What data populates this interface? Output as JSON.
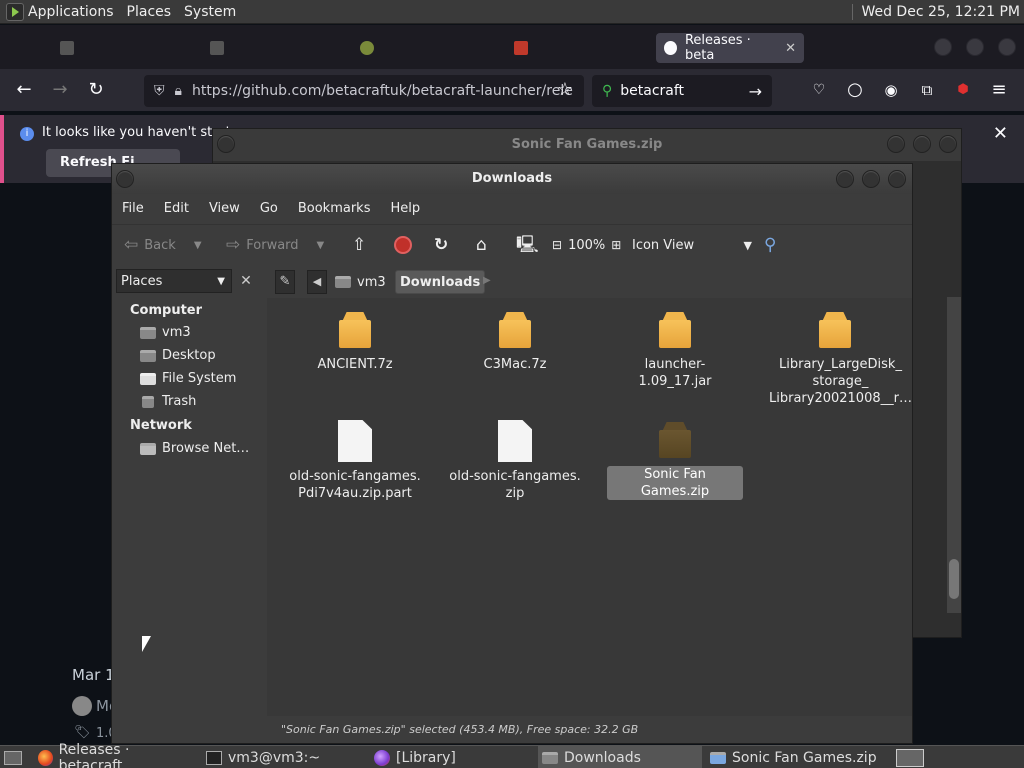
{
  "top_panel": {
    "menus": [
      "Applications",
      "Places",
      "System"
    ],
    "clock": "Wed Dec 25, 12:21 PM"
  },
  "firefox": {
    "active_tab": {
      "title": "Releases · beta",
      "close": "✕"
    },
    "url": "https://github.com/betacraftuk/betacraft-launcher/rele",
    "search_query": "betacraft",
    "notification": {
      "message": "It looks like you haven't start",
      "button": "Refresh Fi",
      "close": "✕"
    },
    "page": {
      "date_fragment": "Mar 1",
      "author_fragment": "Mo",
      "tag_fragment": "1.0"
    }
  },
  "sonic_window": {
    "title": "Sonic Fan Games.zip"
  },
  "nautilus": {
    "title": "Downloads",
    "menu": [
      "File",
      "Edit",
      "View",
      "Go",
      "Bookmarks",
      "Help"
    ],
    "toolbar": {
      "back": "Back",
      "forward": "Forward",
      "zoom": "100%",
      "view": "Icon View"
    },
    "places_header": "Places",
    "sidebar": {
      "computer_header": "Computer",
      "computer_items": [
        "vm3",
        "Desktop",
        "File System",
        "Trash"
      ],
      "network_header": "Network",
      "network_items": [
        "Browse Net…"
      ]
    },
    "path": [
      "vm3",
      "Downloads"
    ],
    "files": [
      {
        "name": "ANCIENT.7z",
        "type": "archive"
      },
      {
        "name": "C3Mac.7z",
        "type": "archive"
      },
      {
        "name": "launcher-1.09_17.jar",
        "type": "archive"
      },
      {
        "name": "Library_LargeDisk_\nstorage_\nLibrary20021008__r…",
        "type": "archive"
      },
      {
        "name": "old-sonic-fangames.\nPdi7v4au.zip.part",
        "type": "document"
      },
      {
        "name": "old-sonic-fangames.\nzip",
        "type": "document"
      },
      {
        "name": "Sonic Fan Games.zip",
        "type": "archive-selected"
      }
    ],
    "status": "\"Sonic Fan Games.zip\" selected (453.4 MB), Free space: 32.2 GB"
  },
  "taskbar": {
    "items": [
      "Releases · betacraft…",
      "vm3@vm3:~",
      "[Library]",
      "Downloads",
      "Sonic Fan Games.zip"
    ]
  },
  "colors": {
    "selection": "#777777",
    "folder": "#f0b54c",
    "notification_accent": "#e0508c"
  }
}
